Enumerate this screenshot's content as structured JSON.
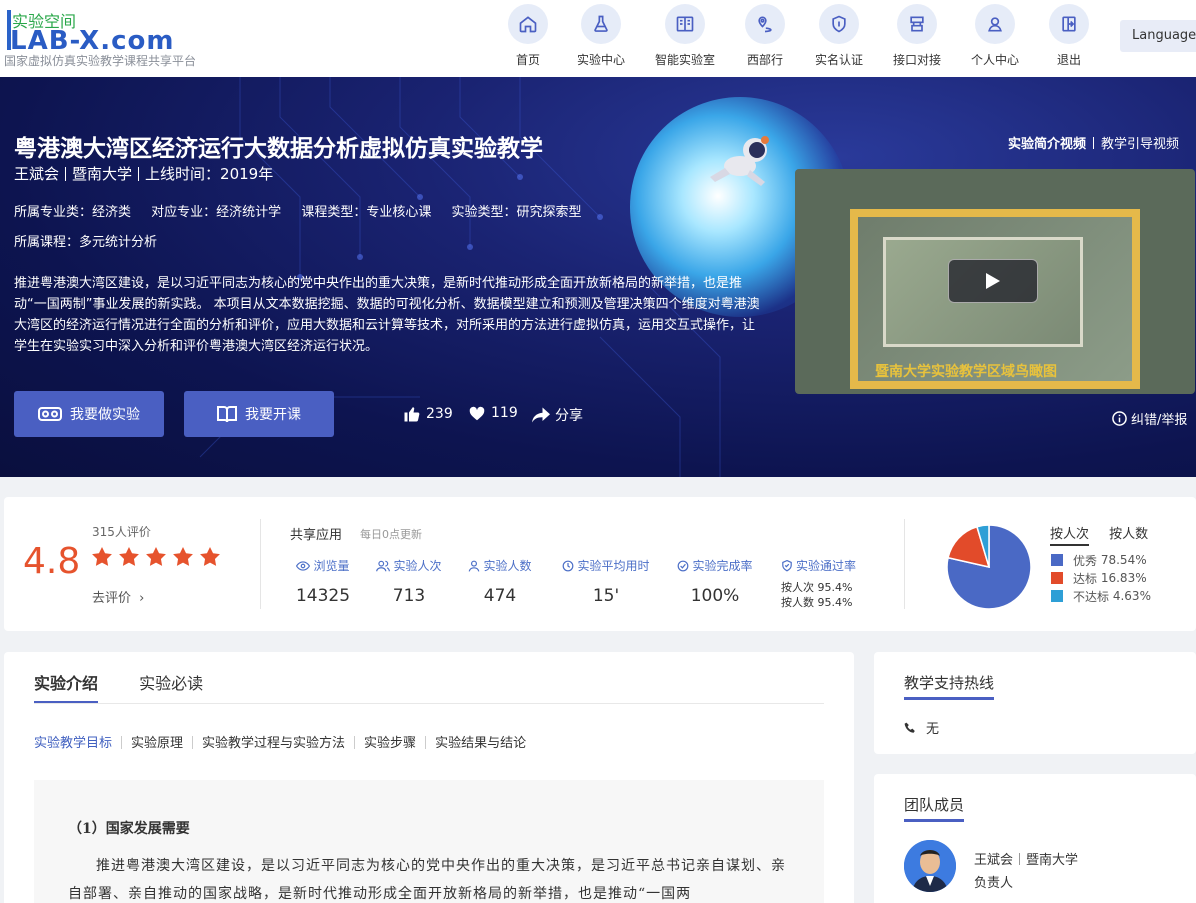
{
  "logo": {
    "top_text": "实验空间",
    "main_text": "LAB-X.com",
    "sub_text": "国家虚拟仿真实验教学课程共享平台"
  },
  "nav": {
    "items": [
      {
        "label": "首页",
        "icon": "home-icon"
      },
      {
        "label": "实验中心",
        "icon": "flask-icon"
      },
      {
        "label": "智能实验室",
        "icon": "book-icon"
      },
      {
        "label": "西部行",
        "icon": "location-icon"
      },
      {
        "label": "实名认证",
        "icon": "shield-icon"
      },
      {
        "label": "接口对接",
        "icon": "connector-icon"
      },
      {
        "label": "个人中心",
        "icon": "user-icon"
      },
      {
        "label": "退出",
        "icon": "logout-icon"
      }
    ],
    "language": "Language"
  },
  "hero": {
    "title": "粤港澳大湾区经济运行大数据分析虚拟仿真实验教学",
    "author": "王斌会",
    "school": "暨南大学",
    "online_time": "上线时间：2019年",
    "tags": [
      "所属专业类：经济类",
      "对应专业：经济统计学",
      "课程类型：专业核心课",
      "实验类型：研究探索型"
    ],
    "course": "所属课程：多元统计分析",
    "description": "推进粤港澳大湾区建设，是以习近平同志为核心的党中央作出的重大决策，是新时代推动形成全面开放新格局的新举措，也是推动“一国两制”事业发展的新实践。 本项目从文本数据挖掘、数据的可视化分析、数据模型建立和预测及管理决策四个维度对粤港澳大湾区的经济运行情况进行全面的分析和评价，应用大数据和云计算等技术，对所采用的方法进行虚拟仿真，运用交互式操作，让学生在实验实习中深入分析和评价粤港澳大湾区经济运行状况。",
    "btn_do": "我要做实验",
    "btn_open": "我要开课",
    "likes": "239",
    "favorites": "119",
    "share": "分享",
    "video_link_1": "实验简介视频",
    "video_link_2": "教学引导视频",
    "video_caption": "暨南大学实验教学区域鸟瞰图",
    "report": "纠错/举报"
  },
  "stats": {
    "rating": "4.8",
    "rating_count": "315人评价",
    "go_rate": "去评价",
    "share_title": "共享应用",
    "share_sub": "每日0点更新",
    "metrics": [
      {
        "label": "浏览量",
        "value": "14325",
        "icon": "eye-icon"
      },
      {
        "label": "实验人次",
        "value": "713",
        "icon": "users-icon"
      },
      {
        "label": "实验人数",
        "value": "474",
        "icon": "person-icon"
      },
      {
        "label": "实验平均用时",
        "value": "15'",
        "icon": "clock-icon"
      },
      {
        "label": "实验完成率",
        "value": "100%",
        "icon": "check-circle-icon"
      }
    ],
    "pass_label": "实验通过率",
    "pass_by_times": "按人次 95.4%",
    "pass_by_people": "按人数 95.4%",
    "pie_tab_active": "按人次",
    "pie_tab": "按人数",
    "pie": [
      {
        "label": "优秀",
        "percent": "78.54%",
        "value": 78.54,
        "color": "#4a69c5"
      },
      {
        "label": "达标",
        "percent": "16.83%",
        "value": 16.83,
        "color": "#e24b2a"
      },
      {
        "label": "不达标",
        "percent": "4.63%",
        "value": 4.63,
        "color": "#2e9fd6"
      }
    ]
  },
  "main": {
    "tab_active": "实验介绍",
    "tab": "实验必读",
    "subnav": [
      "实验教学目标",
      "实验原理",
      "实验教学过程与实验方法",
      "实验步骤",
      "实验结果与结论"
    ],
    "article_heading": "（1）国家发展需要",
    "article_text": "推进粤港澳大湾区建设，是以习近平同志为核心的党中央作出的重大决策，是习近平总书记亲自谋划、亲自部署、亲自推动的国家战略，是新时代推动形成全面开放新格局的新举措，也是推动“一国两"
  },
  "side": {
    "hotline_title": "教学支持热线",
    "hotline_value": "无",
    "team_title": "团队成员",
    "member_name": "王斌会",
    "member_school": "暨南大学",
    "member_role": "负责人"
  },
  "colors": {
    "accent": "#4a5fc2",
    "rating": "#e6532d"
  }
}
